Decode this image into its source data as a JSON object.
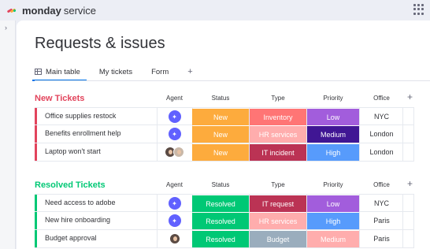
{
  "app": {
    "brand_bold": "monday",
    "brand_light": "service",
    "logo_colors": [
      "#e2445c",
      "#fdab3d",
      "#00c875"
    ]
  },
  "page": {
    "title": "Requests & issues"
  },
  "tabs": [
    {
      "label": "Main table",
      "active": true,
      "icon": "table-icon"
    },
    {
      "label": "My tickets",
      "active": false
    },
    {
      "label": "Form",
      "active": false
    }
  ],
  "tab_add_label": "+",
  "columns": {
    "agent": "Agent",
    "status": "Status",
    "type": "Type",
    "priority": "Priority",
    "office": "Office",
    "add": "+"
  },
  "groups": [
    {
      "title": "New Tickets",
      "color": "#e2445c",
      "rows": [
        {
          "name": "Office supplies restock",
          "agent": "ai",
          "status": {
            "label": "New",
            "color": "#fdab3d"
          },
          "type": {
            "label": "Inventory",
            "color": "#ff7575"
          },
          "priority": {
            "label": "Low",
            "color": "#a25ddc"
          },
          "office": "NYC"
        },
        {
          "name": "Benefits enrollment help",
          "agent": "ai",
          "status": {
            "label": "New",
            "color": "#fdab3d"
          },
          "type": {
            "label": "HR services",
            "color": "#ffadad"
          },
          "priority": {
            "label": "Medium",
            "color": "#401694"
          },
          "office": "London"
        },
        {
          "name": "Laptop won't start",
          "agent": "people",
          "status": {
            "label": "New",
            "color": "#fdab3d"
          },
          "type": {
            "label": "IT incident",
            "color": "#bb3354"
          },
          "priority": {
            "label": "High",
            "color": "#579bfc"
          },
          "office": "London"
        }
      ]
    },
    {
      "title": "Resolved Tickets",
      "color": "#00c875",
      "rows": [
        {
          "name": "Need access to adobe",
          "agent": "ai",
          "status": {
            "label": "Resolved",
            "color": "#00c875"
          },
          "type": {
            "label": "IT request",
            "color": "#bb3354"
          },
          "priority": {
            "label": "Low",
            "color": "#a25ddc"
          },
          "office": "NYC"
        },
        {
          "name": "New hire onboarding",
          "agent": "ai",
          "status": {
            "label": "Resolved",
            "color": "#00c875"
          },
          "type": {
            "label": "HR services",
            "color": "#ffadad"
          },
          "priority": {
            "label": "High",
            "color": "#579bfc"
          },
          "office": "Paris"
        },
        {
          "name": "Budget approval",
          "agent": "person",
          "status": {
            "label": "Resolved",
            "color": "#00c875"
          },
          "type": {
            "label": "Budget",
            "color": "#9aadbd"
          },
          "priority": {
            "label": "Medium",
            "color": "#ffadad"
          },
          "office": "Paris"
        }
      ]
    }
  ]
}
